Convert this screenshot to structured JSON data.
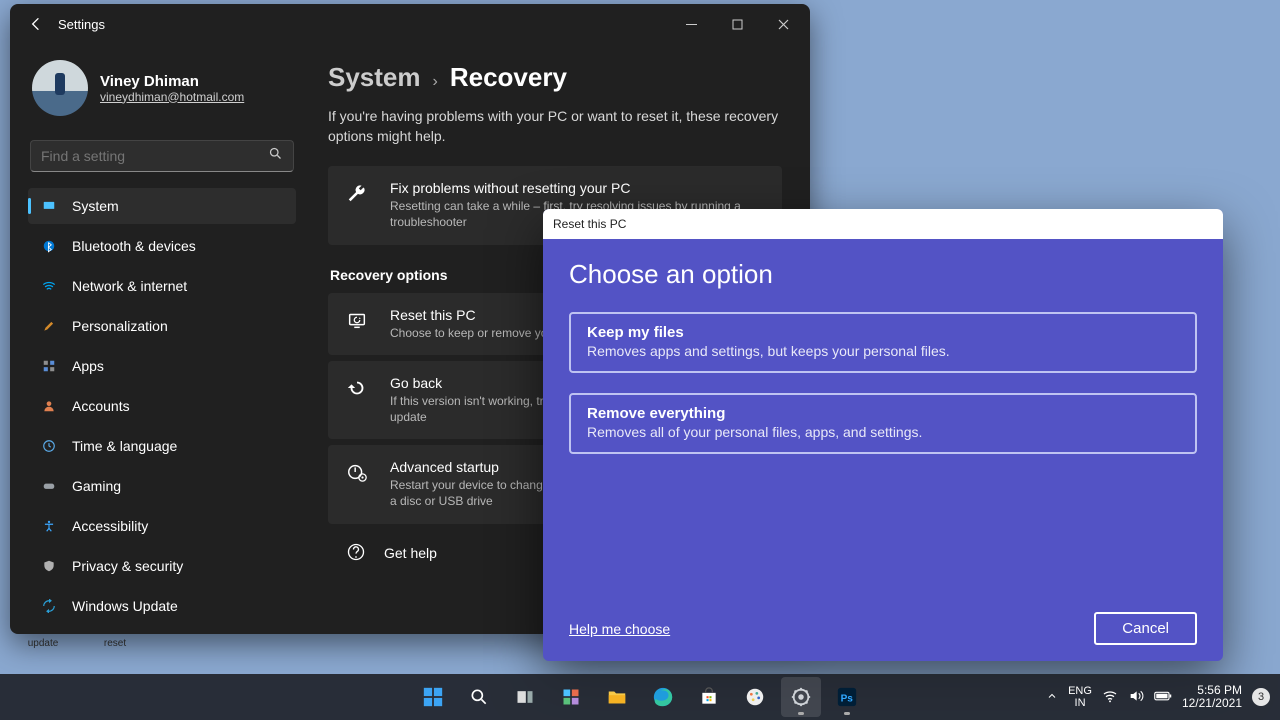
{
  "settings": {
    "titlebar_title": "Settings",
    "account": {
      "name": "Viney Dhiman",
      "email": "vineydhiman@hotmail.com"
    },
    "search_placeholder": "Find a setting",
    "nav": [
      {
        "label": "System"
      },
      {
        "label": "Bluetooth & devices"
      },
      {
        "label": "Network & internet"
      },
      {
        "label": "Personalization"
      },
      {
        "label": "Apps"
      },
      {
        "label": "Accounts"
      },
      {
        "label": "Time & language"
      },
      {
        "label": "Gaming"
      },
      {
        "label": "Accessibility"
      },
      {
        "label": "Privacy & security"
      },
      {
        "label": "Windows Update"
      }
    ],
    "breadcrumb": {
      "root": "System",
      "leaf": "Recovery"
    },
    "page_desc": "If you're having problems with your PC or want to reset it, these recovery options might help.",
    "fix_card": {
      "title": "Fix problems without resetting your PC",
      "desc": "Resetting can take a while – first, try resolving issues by running a troubleshooter"
    },
    "recovery_label": "Recovery options",
    "reset_card": {
      "title": "Reset this PC",
      "desc": "Choose to keep or remove your personal files, then reinstall Windows"
    },
    "goback_card": {
      "title": "Go back",
      "desc": "If this version isn't working, try going back by uninstalling the latest update"
    },
    "advanced_card": {
      "title": "Advanced startup",
      "desc": "Restart your device to change startup settings, including starting from a disc or USB drive"
    },
    "get_help": "Get help"
  },
  "dialog": {
    "titlebar": "Reset this PC",
    "heading": "Choose an option",
    "opt1": {
      "title": "Keep my files",
      "desc": "Removes apps and settings, but keeps your personal files."
    },
    "opt2": {
      "title": "Remove everything",
      "desc": "Removes all of your personal files, apps, and settings."
    },
    "help": "Help me choose",
    "cancel": "Cancel"
  },
  "taskbar": {
    "lang1": "ENG",
    "lang2": "IN",
    "time": "5:56 PM",
    "date": "12/21/2021",
    "notif_count": "3"
  },
  "desktop": {
    "update": "update",
    "reset": "reset"
  }
}
